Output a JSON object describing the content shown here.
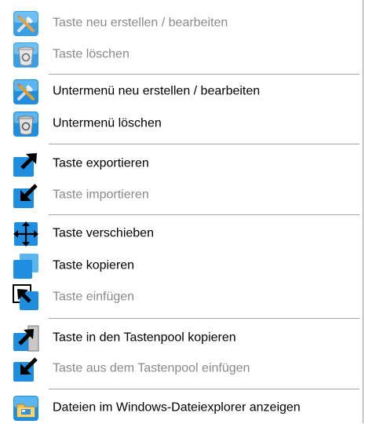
{
  "menu": {
    "items": [
      {
        "label": "Taste neu erstellen / bearbeiten",
        "icon": "tools-icon",
        "enabled": false
      },
      {
        "label": "Taste löschen",
        "icon": "recycle-bin-icon",
        "enabled": false
      },
      {
        "label": "Untermenü neu erstellen / bearbeiten",
        "icon": "tools-icon",
        "enabled": true
      },
      {
        "label": "Untermenü löschen",
        "icon": "recycle-bin-icon",
        "enabled": true
      },
      {
        "label": "Taste exportieren",
        "icon": "export-arrow-icon",
        "enabled": true
      },
      {
        "label": "Taste importieren",
        "icon": "import-arrow-icon",
        "enabled": false
      },
      {
        "label": "Taste verschieben",
        "icon": "move-arrows-icon",
        "enabled": true
      },
      {
        "label": "Taste kopieren",
        "icon": "copy-icon",
        "enabled": true
      },
      {
        "label": "Taste einfügen",
        "icon": "paste-icon",
        "enabled": false
      },
      {
        "label": "Taste in den Tastenpool kopieren",
        "icon": "pool-copy-icon",
        "enabled": true
      },
      {
        "label": "Taste aus dem Tastenpool einfügen",
        "icon": "pool-paste-icon",
        "enabled": false
      },
      {
        "label": "Dateien im Windows-Dateiexplorer anzeigen",
        "icon": "file-explorer-icon",
        "enabled": true
      }
    ]
  },
  "colors": {
    "accent_blue": "#1e8fe0",
    "disabled_text": "#8a8a8a",
    "enabled_text": "#000000",
    "separator": "#a6a6a6"
  }
}
